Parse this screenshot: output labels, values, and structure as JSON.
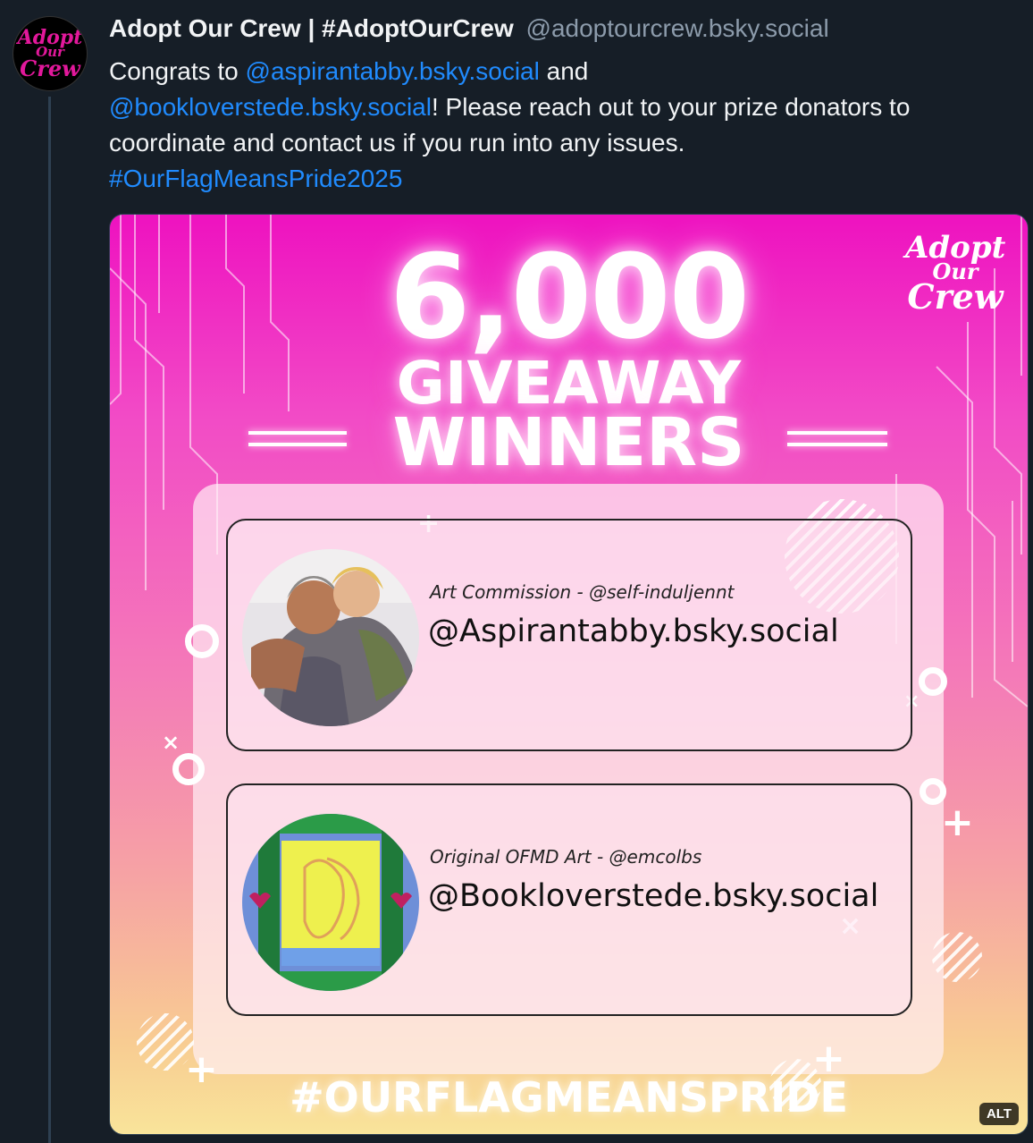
{
  "post": {
    "display_name": "Adopt Our Crew | #AdoptOurCrew",
    "handle": "@adoptourcrew.bsky.social",
    "avatar_text": [
      "Adopt",
      "Our",
      "Crew"
    ],
    "text_parts": {
      "t1": "Congrats to ",
      "mention1": "@aspirantabby.bsky.social",
      "t2": " and ",
      "mention2": "@bookloverstede.bsky.social",
      "t3": "! Please reach out to your prize donators to coordinate and contact us if you run into any issues.",
      "hashtag": "#OurFlagMeansPride2025"
    },
    "link_color": "#208bfe"
  },
  "image": {
    "number": "6,000",
    "title_line1": "GIVEAWAY",
    "title_line2": "WINNERS",
    "brand": [
      "Adopt",
      "Our",
      "Crew"
    ],
    "winners": [
      {
        "prize": "Art Commission - @self-induljennt",
        "handle": "@Aspirantabby.bsky.social"
      },
      {
        "prize": "Original OFMD Art - @emcolbs",
        "handle": "@Bookloverstede.bsky.social"
      }
    ],
    "banner": "#OURFLAGMEANSPRIDE",
    "alt_badge": "ALT",
    "symbols": {
      "plus": "+",
      "cross": "×"
    }
  }
}
